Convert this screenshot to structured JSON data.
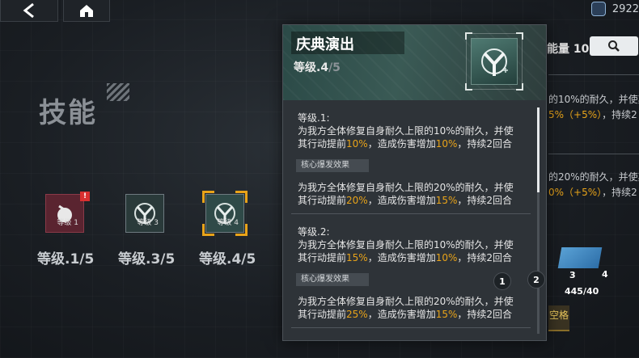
{
  "nav": {
    "back_icon": "chevron-left-icon",
    "home_icon": "home-icon"
  },
  "currency": {
    "icon": "cube-icon",
    "amount": "2922"
  },
  "skills": {
    "heading": "技能",
    "nodes": [
      {
        "small_level": "等级 1",
        "label": "等级.1/5",
        "badge": "!",
        "state": "alert"
      },
      {
        "small_level": "等级 3",
        "label": "等级.3/5",
        "state": "normal"
      },
      {
        "small_level": "等级 4",
        "label": "等级.4/5",
        "state": "selected"
      }
    ]
  },
  "detail": {
    "title": "庆典演出",
    "level_current": "等级.4",
    "level_max": "/5",
    "entries": [
      {
        "title": "等级.1:",
        "line1": "为我方全体修复自身耐久上限的10%的耐久，并使",
        "line2_a": "其行动提前",
        "line2_v1": "10%",
        "line2_b": "，造成伤害增加",
        "line2_v2": "10%",
        "line2_c": "，持续2回合",
        "core_label": "核心爆发效果",
        "core_line1": "为我方全体修复自身耐久上限的20%的耐久，并使",
        "core_a": "其行动提前",
        "core_v1": "20%",
        "core_b": "，造成伤害增加",
        "core_v2": "15%",
        "core_c": "，持续2回合"
      },
      {
        "title": "等级.2:",
        "line1": "为我方全体修复自身耐久上限的10%的耐久，并使",
        "line2_a": "其行动提前",
        "line2_v1": "15%",
        "line2_b": "，造成伤害增加",
        "line2_v2": "10%",
        "line2_c": "，持续2回合",
        "core_label": "核心爆发效果",
        "core_line1": "为我方全体修复自身耐久上限的20%的耐久，并使",
        "core_a": "其行动提前",
        "core_v1": "25%",
        "core_b": "，造成伤害增加",
        "core_v2": "15%",
        "core_c": "，持续2回合"
      }
    ]
  },
  "right_panel": {
    "energy": "能量 10",
    "search_icon": "search-icon",
    "text1_a": "的10%的耐久，并使其",
    "text1_b": "5%（+5%）",
    "text1_c": "，持续2",
    "text2_a": "的20%的耐久，并使其",
    "text2_b": "0%（+5%）",
    "text2_c": "，持续2",
    "card_left": "3",
    "card_right": "4",
    "card_count": "445/40",
    "space_label": "空格"
  },
  "markers": [
    "1",
    "2"
  ]
}
